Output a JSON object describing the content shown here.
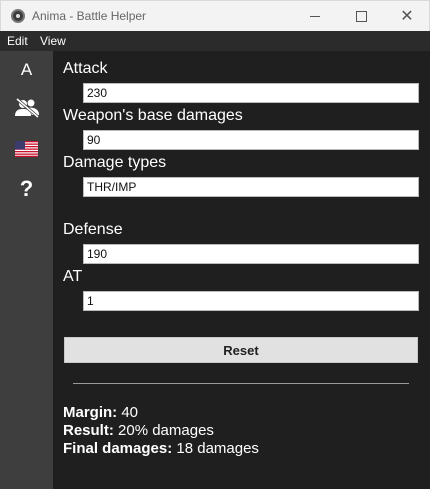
{
  "window": {
    "title": "Anima - Battle Helper",
    "minimize_glyph": "",
    "close_glyph": "✕"
  },
  "menu": {
    "edit": "Edit",
    "view": "View"
  },
  "sidebar": {
    "items": [
      {
        "icon": "letter-a-icon",
        "glyph": "A"
      },
      {
        "icon": "people-off-icon"
      },
      {
        "icon": "us-flag-icon"
      },
      {
        "icon": "question-icon",
        "glyph": "?"
      }
    ]
  },
  "form": {
    "attack_label": "Attack",
    "attack_value": "230",
    "base_damage_label": "Weapon's base damages",
    "base_damage_value": "90",
    "damage_types_label": "Damage types",
    "damage_types_value": "THR/IMP",
    "defense_label": "Defense",
    "defense_value": "190",
    "at_label": "AT",
    "at_value": "1",
    "reset_label": "Reset"
  },
  "results": {
    "margin_label": "Margin:",
    "margin_value": "40",
    "result_label": "Result:",
    "result_value": "20% damages",
    "final_label": "Final damages:",
    "final_value": "18 damages"
  },
  "colors": {
    "background": "#1f1f1f",
    "sidebar": "#3e3e3e",
    "menubar": "#2b2b2b",
    "titlebar": "#f3f3f3"
  }
}
